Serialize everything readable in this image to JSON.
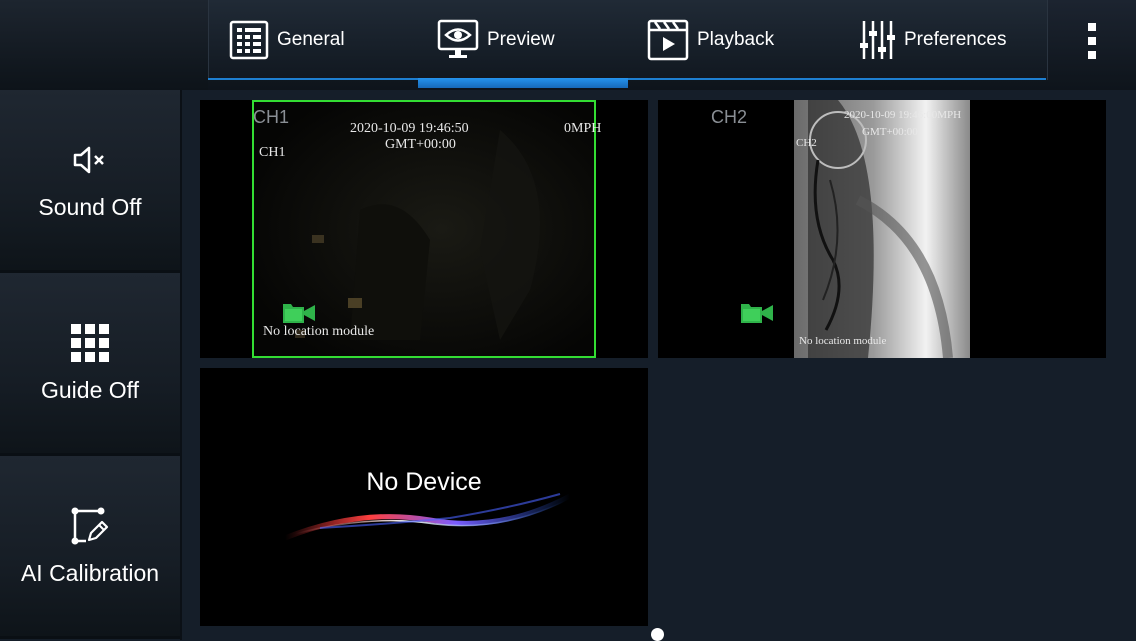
{
  "tabs": [
    {
      "id": "general",
      "label": "General",
      "icon": "grid-list-icon"
    },
    {
      "id": "preview",
      "label": "Preview",
      "icon": "monitor-eye-icon",
      "active": true
    },
    {
      "id": "playback",
      "label": "Playback",
      "icon": "clapper-play-icon"
    },
    {
      "id": "preferences",
      "label": "Preferences",
      "icon": "sliders-icon"
    }
  ],
  "sidebar": {
    "items": [
      {
        "label": "Sound Off",
        "icon": "speaker-mute-icon"
      },
      {
        "label": "Guide Off",
        "icon": "grid-icon"
      },
      {
        "label": "AI Calibration",
        "icon": "calibration-pen-icon"
      }
    ]
  },
  "channels": {
    "ch1": {
      "label": "CH1",
      "osd_datetime": "2020-10-09 19:46:50",
      "osd_timezone": "GMT+00:00",
      "osd_speed": "0MPH",
      "osd_channel": "CH1",
      "osd_location": "No location module"
    },
    "ch2": {
      "label": "CH2",
      "osd_datetime": "2020-10-09 19:46:00MPH",
      "osd_timezone": "GMT+00:00",
      "osd_channel": "CH2",
      "osd_location": "No location module"
    },
    "ch3": {
      "status": "No Device"
    }
  },
  "colors": {
    "accent": "#1e7fd0",
    "selected_border": "#33dd33",
    "rec_icon": "#2fb34a"
  }
}
